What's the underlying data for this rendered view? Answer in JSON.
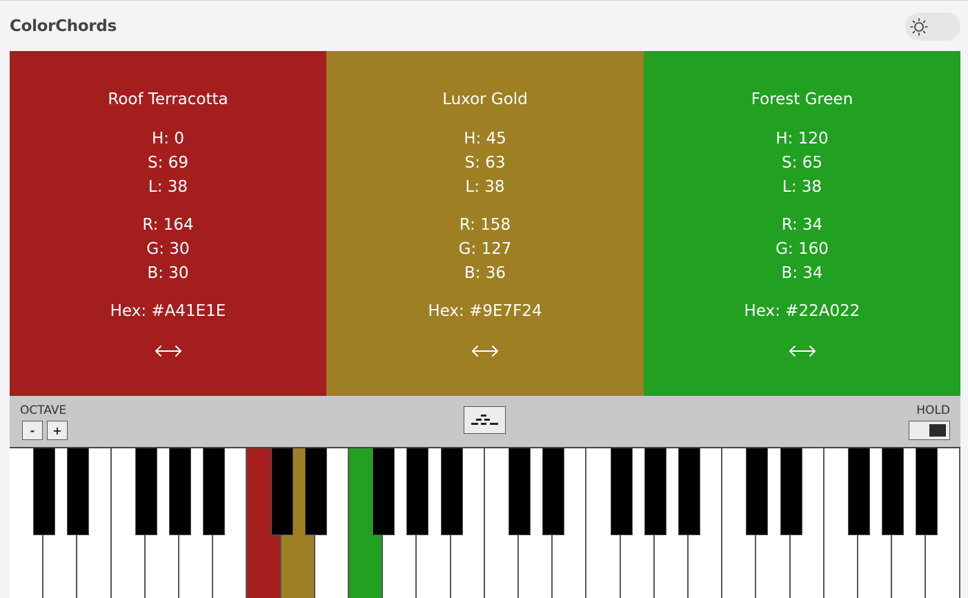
{
  "app": {
    "title": "ColorChords"
  },
  "theme_toggle": {
    "icon": "sun-icon"
  },
  "swatches": [
    {
      "name": "Roof Terracotta",
      "color": "#A41E1E",
      "h": "H: 0",
      "s": "S: 69",
      "l": "L: 38",
      "r": "R: 164",
      "g": "G: 30",
      "b": "B: 30",
      "hex": "Hex: #A41E1E",
      "swap_icon": "left-right-arrow-icon"
    },
    {
      "name": "Luxor Gold",
      "color": "#9E7F24",
      "h": "H: 45",
      "s": "S: 63",
      "l": "L: 38",
      "r": "R: 158",
      "g": "G: 127",
      "b": "B: 36",
      "hex": "Hex: #9E7F24",
      "swap_icon": "left-right-arrow-icon"
    },
    {
      "name": "Forest Green",
      "color": "#22A022",
      "h": "H: 120",
      "s": "S: 65",
      "l": "L: 38",
      "r": "R: 34",
      "g": "G: 160",
      "b": "B: 34",
      "hex": "Hex: #22A022",
      "swap_icon": "left-right-arrow-icon"
    }
  ],
  "controls": {
    "octave_label": "OCTAVE",
    "octave_down": "-",
    "octave_up": "+",
    "center_icon": "chord-stack-icon",
    "hold_label": "HOLD",
    "hold_on": true
  },
  "piano": {
    "white_key_count": 28,
    "active_white_keys": [
      {
        "index": 7,
        "color": "#A41E1E"
      },
      {
        "index": 8,
        "color": "#9E7F24"
      },
      {
        "index": 10,
        "color": "#22A022"
      }
    ]
  }
}
